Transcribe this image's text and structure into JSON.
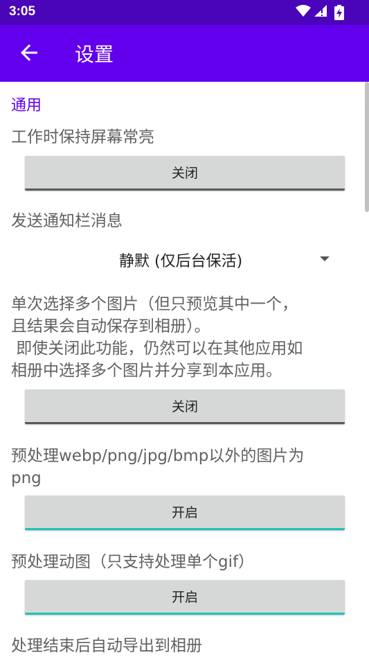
{
  "status_bar": {
    "time": "3:05",
    "icons": [
      "wifi-icon",
      "signal-icon",
      "battery-charging-icon"
    ]
  },
  "app_bar": {
    "back_icon": "arrow-back-icon",
    "title": "设置"
  },
  "sections": [
    {
      "header": "通用",
      "settings": [
        {
          "label": "工作时保持屏幕常亮",
          "type": "toggle",
          "value": "关闭",
          "enabled": false
        },
        {
          "label": "发送通知栏消息",
          "type": "dropdown",
          "value": "静默 (仅后台保活)"
        },
        {
          "label_lines": [
            "单次选择多个图片（但只预览其中一个，",
            "且结果会自动保存到相册）。",
            " 即使关闭此功能，仍然可以在其他应用如",
            "相册中选择多个图片并分享到本应用。"
          ],
          "type": "toggle",
          "value": "关闭",
          "enabled": false
        },
        {
          "label_lines": [
            "预处理webp/png/jpg/bmp以外的图片为",
            "png"
          ],
          "type": "toggle",
          "value": "开启",
          "enabled": true
        },
        {
          "label": "预处理动图（只支持处理单个gif）",
          "type": "toggle",
          "value": "开启",
          "enabled": true
        },
        {
          "label": "处理结束后自动导出到相册",
          "type": "toggle"
        }
      ]
    }
  ],
  "colors": {
    "status_bar": "#4a04b9",
    "app_bar": "#6200ee",
    "accent": "#6200ee",
    "toggle_on": "#1ec3b3",
    "toggle_off": "#5a5a5a"
  }
}
